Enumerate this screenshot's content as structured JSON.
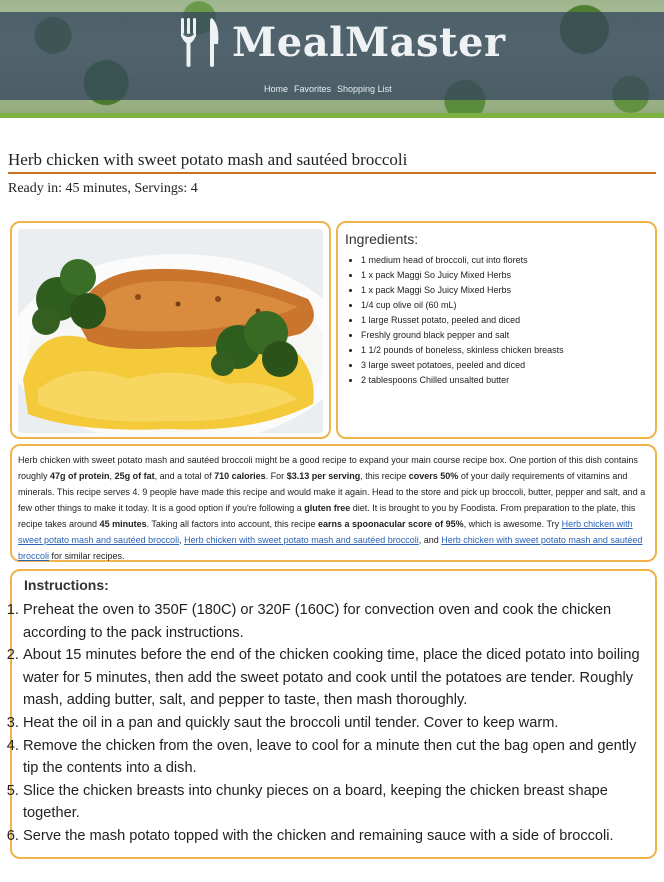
{
  "header": {
    "brand": "MealMaster",
    "nav": [
      "Home",
      "Favorites",
      "Shopping List"
    ]
  },
  "recipe": {
    "title": "Herb chicken with sweet potato mash and sautéed broccoli",
    "meta": "Ready in: 45 minutes, Servings: 4"
  },
  "ingredients": {
    "heading": "Ingredients:",
    "items": [
      "1 medium head of broccoli, cut into florets",
      "1 x pack Maggi So Juicy Mixed Herbs",
      "1 x pack Maggi So Juicy Mixed Herbs",
      "1/4 cup olive oil (60 mL)",
      "1 large Russet potato, peeled and diced",
      "Freshly ground black pepper and salt",
      "1 1/2 pounds of boneless, skinless chicken breasts",
      "3 large sweet potatoes, peeled and diced",
      "2 tablespoons Chilled unsalted butter"
    ]
  },
  "summary": {
    "t1": "Herb chicken with sweet potato mash and sautéed broccoli might be a good recipe to expand your main course recipe box. One portion of this dish contains roughly ",
    "b1": "47g of protein",
    "t2": ", ",
    "b2": "25g of fat",
    "t3": ", and a total of ",
    "b3": "710 calories",
    "t4": ". For ",
    "b4": "$3.13 per serving",
    "t5": ", this recipe ",
    "b5": "covers 50%",
    "t6": " of your daily requirements of vitamins and minerals. This recipe serves 4. 9 people have made this recipe and would make it again. Head to the store and pick up broccoli, butter, pepper and salt, and a few other things to make it today. It is a good option if you're following a ",
    "b6": "gluten free",
    "t7": " diet. It is brought to you by Foodista. From preparation to the plate, this recipe takes around ",
    "b7": "45 minutes",
    "t8": ". Taking all factors into account, this recipe ",
    "b8": "earns a spoonacular score of 95%",
    "t9": ", which is awesome. Try ",
    "link1": "Herb chicken with sweet potato mash and sautéed broccoli",
    "t10": ", ",
    "link2": "Herb chicken with sweet potato mash and sautéed broccoli",
    "t11": ", and ",
    "link3": "Herb chicken with sweet potato mash and sautéed broccoli",
    "t12": " for similar recipes."
  },
  "instructions": {
    "heading": "Instructions:",
    "steps": [
      "Preheat the oven to 350F (180C) or 320F (160C) for convection oven and cook the chicken according to the pack instructions.",
      "About 15 minutes before the end of the chicken cooking time, place the diced potato into boiling water for 5 minutes, then add the sweet potato and cook until the potatoes are tender. Roughly mash, adding butter, salt, and pepper to taste, then mash thoroughly.",
      "Heat the oil in a pan and quickly saut the broccoli until tender. Cover to keep warm.",
      "Remove the chicken from the oven, leave to cool for a minute then cut the bag open and gently tip the contents into a dish.",
      "Slice the chicken breasts into chunky pieces on a board, keeping the chicken breast shape together.",
      "Serve the mash potato topped with the chicken and remaining sauce with a side of broccoli."
    ]
  },
  "colors": {
    "accent_border": "#f0b34a",
    "title_underline": "#c8711e",
    "header_band": "#34465c",
    "header_green": "#7db243",
    "link": "#2a62b8"
  }
}
